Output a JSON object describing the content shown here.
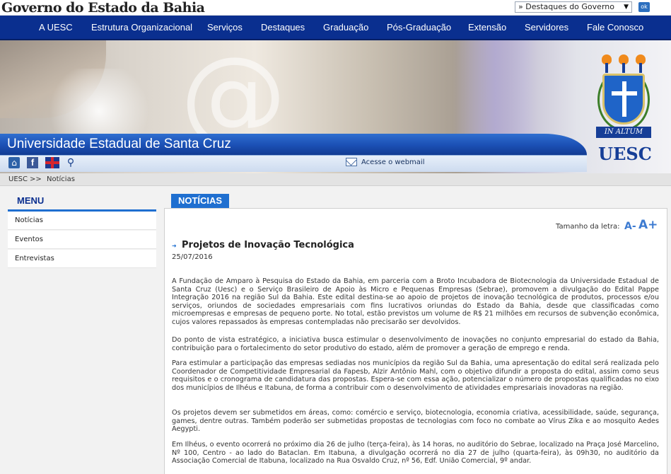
{
  "gov_bar": {
    "title": "Governo do Estado da Bahia",
    "highlights_select": "» Destaques do Governo",
    "ok_label": "ok"
  },
  "nav": {
    "items": [
      "A UESC",
      "Estrutura Organizacional",
      "Serviços",
      "Destaques",
      "Graduação",
      "Pós-Graduação",
      "Extensão",
      "Servidores",
      "Fale Conosco"
    ]
  },
  "banner": {
    "university_name": "Universidade Estadual de Santa Cruz",
    "webmail_label": "Acesse o webmail",
    "crest_motto": "IN ALTUM",
    "crest_acronym": "UESC"
  },
  "breadcrumb": {
    "home": "UESC",
    "separator": ">>",
    "current": "Notícias"
  },
  "sidebar": {
    "title": "MENU",
    "items": [
      "Notícias",
      "Eventos",
      "Entrevistas"
    ]
  },
  "content": {
    "tab_label": "NOTÍCIAS",
    "font_size_label": "Tamanho da letra:",
    "font_decrease": "A-",
    "font_increase": "A+",
    "article": {
      "title": "Projetos de Inovação Tecnológica",
      "date": "25/07/2016",
      "paragraphs": [
        "A Fundação de Amparo à Pesquisa do Estado da Bahia, em parceria com a Broto Incubadora de Biotecnologia da Universidade Estadual de Santa Cruz (Uesc) e o Serviço Brasileiro de Apoio às Micro e Pequenas Empresas (Sebrae), promovem a divulgação do Edital Pappe Integração 2016 na região Sul da Bahia. Este edital destina-se ao apoio de projetos de inovação tecnológica de produtos, processos e/ou serviços, oriundos de sociedades empresariais com fins lucrativos oriundas do Estado da Bahia, desde que classificadas como microempresas e empresas de pequeno porte. No total, estão previstos um volume de R$ 21 milhões em recursos de subvenção econômica, cujos valores repassados às empresas contempladas não precisarão ser devolvidos.",
        "Do ponto de vista estratégico, a iniciativa busca estimular o desenvolvimento de inovações no conjunto empresarial do estado da Bahia, contribuição para o fortalecimento do setor produtivo do estado, além de promover a geração de emprego e renda.",
        "Para estimular a participação das empresas sediadas nos municípios da região Sul da Bahia, uma apresentação do edital será realizada pelo Coordenador de Competitividade Empresarial da Fapesb, Alzir Antônio Mahl, com o objetivo difundir a proposta do edital, assim como seus requisitos e o cronograma de candidatura das propostas. Espera-se com essa ação, potencializar o número de propostas qualificadas no eixo dos municípios de Ilhéus e Itabuna, de forma a contribuir com o desenvolvimento de atividades empresariais inovadoras na região.",
        "Os projetos devem ser submetidos em áreas, como: comércio e serviço, biotecnologia, economia criativa, acessibilidade, saúde, segurança, games, dentre outras. Também poderão ser submetidas propostas de tecnologias com foco no combate ao Vírus Zika e ao mosquito Aedes Aegypti.",
        "Em Ilhéus, o evento ocorrerá no próximo dia 26 de julho (terça-feira), às 14 horas, no auditório do Sebrae, localizado na Praça José Marcelino, Nº 100, Centro - ao lado do Bataclan. Em Itabuna, a divulgação ocorrerá no dia 27 de julho (quarta-feira), às 09h30, no auditório da Associação Comercial de Itabuna, localizado na Rua Osvaldo Cruz, nº 56, Edf. União Comercial, 9º andar."
      ]
    }
  }
}
